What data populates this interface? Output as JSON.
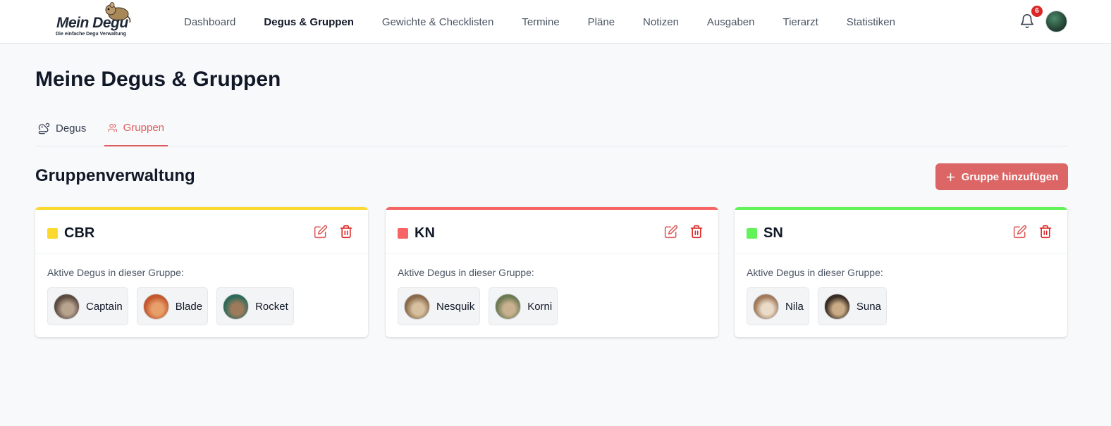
{
  "app": {
    "logo_title": "Mein Degu",
    "logo_subtitle": "Die einfache Degu Verwaltung"
  },
  "nav": {
    "items": [
      {
        "label": "Dashboard",
        "active": false
      },
      {
        "label": "Degus & Gruppen",
        "active": true
      },
      {
        "label": "Gewichte & Checklisten",
        "active": false
      },
      {
        "label": "Termine",
        "active": false
      },
      {
        "label": "Pläne",
        "active": false
      },
      {
        "label": "Notizen",
        "active": false
      },
      {
        "label": "Ausgaben",
        "active": false
      },
      {
        "label": "Tierarzt",
        "active": false
      },
      {
        "label": "Statistiken",
        "active": false
      }
    ],
    "notification_count": "6"
  },
  "page": {
    "title": "Meine Degus & Gruppen",
    "tabs": [
      {
        "label": "Degus",
        "icon": "rat-icon",
        "active": false
      },
      {
        "label": "Gruppen",
        "icon": "users-icon",
        "active": true
      }
    ],
    "section_title": "Gruppenverwaltung",
    "add_button": "Gruppe hinzufügen",
    "active_label": "Aktive Degus in dieser Gruppe:"
  },
  "groups": [
    {
      "name": "CBR",
      "color": "#fcd92f",
      "degus": [
        {
          "name": "Captain",
          "photo_colors": [
            "#5b4a3f",
            "#b8a38f"
          ]
        },
        {
          "name": "Blade",
          "photo_colors": [
            "#c4572d",
            "#e8a06a"
          ]
        },
        {
          "name": "Rocket",
          "photo_colors": [
            "#2f6b5a",
            "#9e7a5c"
          ]
        }
      ]
    },
    {
      "name": "KN",
      "color": "#f56565",
      "degus": [
        {
          "name": "Nesquik",
          "photo_colors": [
            "#8a6a4a",
            "#d7c0a0"
          ]
        },
        {
          "name": "Korni",
          "photo_colors": [
            "#6c7a52",
            "#c9b18f"
          ]
        }
      ]
    },
    {
      "name": "SN",
      "color": "#62f25a",
      "degus": [
        {
          "name": "Nila",
          "photo_colors": [
            "#a07a5a",
            "#eadbc8"
          ]
        },
        {
          "name": "Suna",
          "photo_colors": [
            "#3a2c24",
            "#c9ab85"
          ]
        }
      ]
    }
  ],
  "colors": {
    "accent": "#dc6565",
    "active_tab": "#dc5c5c"
  }
}
